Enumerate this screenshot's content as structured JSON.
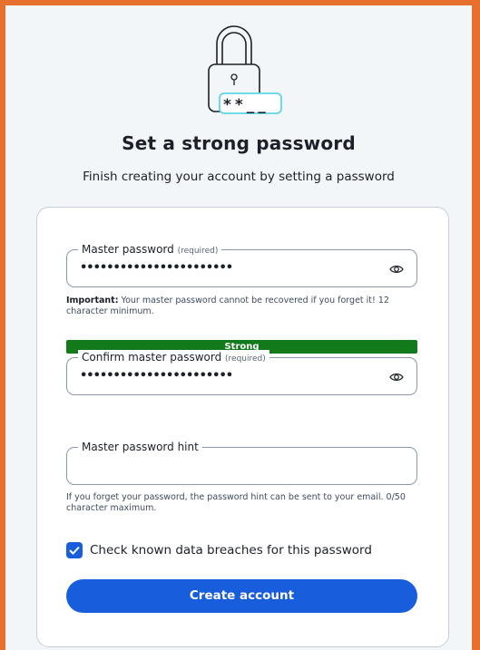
{
  "page": {
    "title": "Set a strong password",
    "subtitle": "Finish creating your account by setting a password",
    "illustration_icon": "padlock-with-password-icon",
    "illustration_text": "**__"
  },
  "master_password": {
    "label": "Master password",
    "required": "(required)",
    "value": "•••••••••••••••••••••••",
    "toggle_icon": "eye-icon"
  },
  "master_helper": {
    "important_label": "Important:",
    "text": "Your master password cannot be recovered if you forget it! 12 character minimum."
  },
  "strength": {
    "label": "Strong",
    "color": "#137a1c",
    "level": 1.0
  },
  "confirm_password": {
    "label": "Confirm master password",
    "required": "(required)",
    "value": "•••••••••••••••••••••••",
    "toggle_icon": "eye-icon"
  },
  "hint": {
    "label": "Master password hint",
    "value": "",
    "helper": "If you forget your password, the password hint can be sent to your email. 0/50 character maximum."
  },
  "breach_check": {
    "checked": true,
    "label": "Check known data breaches for this password"
  },
  "submit": {
    "label": "Create account"
  },
  "colors": {
    "accent": "#175ddc",
    "frame": "#e8702e",
    "background": "#f3f6f9",
    "illustration": "#1b2029",
    "illustration_highlight": "#5fd6e6"
  }
}
